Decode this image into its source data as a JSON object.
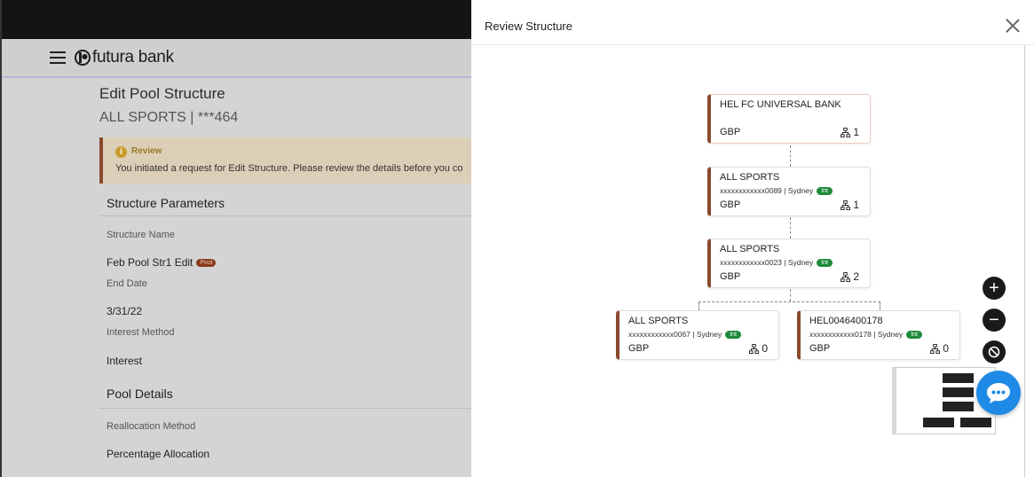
{
  "app": {
    "brand": "futura bank",
    "page_title": "Edit Pool Structure",
    "page_subtitle": "ALL SPORTS | ***464"
  },
  "review": {
    "title": "Review",
    "message": "You initiated a request for Edit Structure. Please review the details before you co"
  },
  "structure_parameters": {
    "heading": "Structure Parameters",
    "fields": [
      {
        "label": "Structure Name",
        "value": "Feb Pool Str1 Edit",
        "badge": "Pool"
      },
      {
        "label": "End Date",
        "value": "3/31/22"
      },
      {
        "label": "Interest Method",
        "value": "Interest"
      }
    ]
  },
  "pool_details": {
    "heading": "Pool Details",
    "fields": [
      {
        "label": "Reallocation Method",
        "value": "Percentage Allocation"
      }
    ]
  },
  "modal": {
    "title": "Review Structure",
    "close_label": "Close"
  },
  "tree": {
    "root": {
      "name": "HEL FC UNIVERSAL BANK",
      "currency": "GBP",
      "count": "1"
    },
    "level1": {
      "name": "ALL SPORTS",
      "account": "xxxxxxxxxxxx0089 | Sydney",
      "badge": "Int",
      "currency": "GBP",
      "count": "1"
    },
    "level2": {
      "name": "ALL SPORTS",
      "account": "xxxxxxxxxxxx0023 | Sydney",
      "badge": "Int",
      "currency": "GBP",
      "count": "2"
    },
    "leaves": [
      {
        "name": "ALL SPORTS",
        "account": "xxxxxxxxxxxx0067 | Sydney",
        "badge": "Int",
        "currency": "GBP",
        "count": "0"
      },
      {
        "name": "HEL0046400178",
        "account": "xxxxxxxxxxxx0178 | Sydney",
        "badge": "Int",
        "currency": "GBP",
        "count": "0"
      }
    ]
  },
  "controls": {
    "zoom_in": "+",
    "zoom_out": "−"
  },
  "colors": {
    "accent": "#8a4a2e",
    "int_badge": "#1e8a3a",
    "chat": "#1e8ae6"
  }
}
